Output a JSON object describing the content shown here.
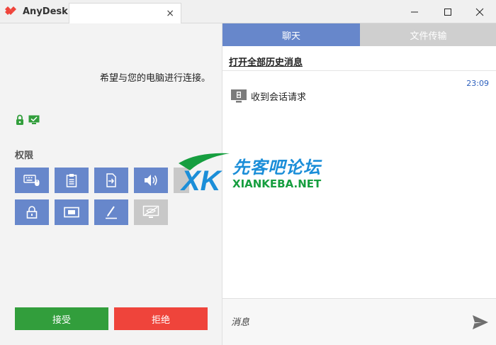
{
  "app": {
    "title": "AnyDesk"
  },
  "tab": {
    "close_glyph": "×"
  },
  "window_controls": {
    "minimize": "minimize-icon",
    "maximize": "maximize-icon",
    "close": "close-icon"
  },
  "left": {
    "request_text": "希望与您的电脑进行连接。",
    "permissions_title": "权限",
    "permissions": [
      {
        "name": "keyboard-mouse-icon",
        "enabled": true
      },
      {
        "name": "clipboard-icon",
        "enabled": true
      },
      {
        "name": "file-transfer-icon",
        "enabled": true
      },
      {
        "name": "sound-icon",
        "enabled": true
      },
      {
        "name": "lock-icon",
        "enabled": true
      },
      {
        "name": "camera-icon",
        "enabled": true
      },
      {
        "name": "draw-icon",
        "enabled": true
      },
      {
        "name": "privacy-screen-icon",
        "enabled": false
      }
    ],
    "accept_label": "接受",
    "reject_label": "拒绝"
  },
  "right": {
    "tabs": [
      {
        "label": "聊天",
        "active": true
      },
      {
        "label": "文件传输",
        "active": false
      }
    ],
    "history_link": "打开全部历史消息",
    "messages": [
      {
        "time": "23:09",
        "text": "收到会话请求"
      }
    ],
    "input_placeholder": "消息"
  },
  "watermark": {
    "cn": "先客吧论坛",
    "en": "XIANKEBA.NET"
  },
  "colors": {
    "accent": "#6787cb",
    "accept": "#329e3c",
    "reject": "#ef443b",
    "logo": "#ef443b"
  }
}
